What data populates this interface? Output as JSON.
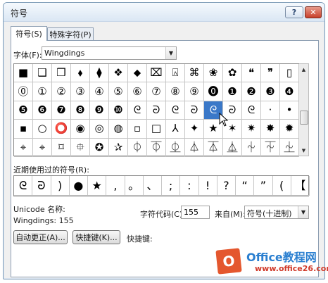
{
  "window": {
    "title": "符号",
    "help_label": "?",
    "close_label": "✕"
  },
  "tabs": [
    {
      "label": "符号(S)",
      "active": true
    },
    {
      "label": "特殊字符(P)",
      "active": false
    }
  ],
  "font": {
    "label": "字体(F):",
    "value": "Wingdings"
  },
  "symbol_grid": {
    "rows": [
      [
        "■",
        "❑",
        "❒",
        "⬧",
        "⧫",
        "❖",
        "⬥",
        "⌧",
        "⍓",
        "⌘",
        "❀",
        "✿",
        "❝",
        "❞",
        "▯"
      ],
      [
        "⓪",
        "①",
        "②",
        "③",
        "④",
        "⑤",
        "⑥",
        "⑦",
        "⑧",
        "⑨",
        "⓿",
        "❶",
        "❷",
        "❸",
        "❹"
      ],
      [
        "❺",
        "❻",
        "❼",
        "❽",
        "❾",
        "❿",
        "ᘓ",
        "ᘒ",
        "ᘓ",
        "ᘒ",
        "ᘓ",
        "ᘒ",
        "ᘓ",
        "·",
        "•"
      ],
      [
        "▪",
        "○",
        "⭕",
        "◉",
        "◎",
        "◍",
        "▫",
        "□",
        "⅄",
        "✦",
        "★",
        "✶",
        "✷",
        "✸",
        "✹"
      ],
      [
        "⌖",
        "⌖",
        "⌑",
        "⯐",
        "✪",
        "✰",
        "⏀",
        "⏁",
        "⏂",
        "⏃",
        "⏄",
        "⏅",
        "⏆",
        "⏇",
        "⏈"
      ]
    ],
    "selected": {
      "row": 2,
      "col": 10
    }
  },
  "recent": {
    "label": "近期使用过的符号(R):",
    "symbols": [
      "ᘓ",
      "ᘒ",
      ")",
      "●",
      "★",
      ",",
      "。",
      "、",
      ";",
      ":",
      "!",
      "?",
      "“",
      "”",
      "(",
      "【"
    ]
  },
  "unicode": {
    "name_label": "Unicode 名称:",
    "value": "Wingdings: 155"
  },
  "char_code": {
    "label": "字符代码(C):",
    "value": "155"
  },
  "from": {
    "label": "来自(M):",
    "value": "符号(十进制)"
  },
  "buttons": {
    "autocorrect": "自动更正(A)...",
    "shortcut_key": "快捷键(K)...",
    "shortcut_label": "快捷键:"
  },
  "watermark": {
    "logo_letter": "O",
    "text": "Office教程网",
    "url": "www.office26.com"
  },
  "colors": {
    "selection": "#3a78c8",
    "titlebar": "#dbe7f4",
    "close": "#c8402b"
  }
}
